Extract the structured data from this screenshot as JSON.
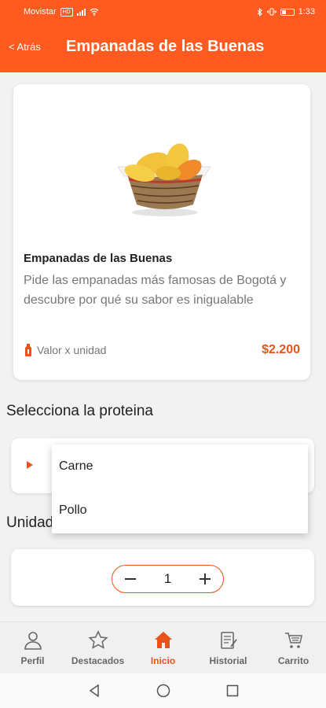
{
  "status_bar": {
    "carrier": "Movistar",
    "network_badge": "HD",
    "time": "1:33"
  },
  "app_bar": {
    "back_label": "< Atrás",
    "title": "Empanadas de las Buenas"
  },
  "product": {
    "name": "Empanadas de las Buenas",
    "description": "Pide las empanadas más famosas de Bogotá y descubre por qué su sabor es inigualable",
    "unit_label": "Valor x unidad",
    "price": "$2.200",
    "image_icon": "empanada-basket-image"
  },
  "protein_section": {
    "title": "Selecciona la proteina",
    "options": [
      "Carne",
      "Pollo"
    ]
  },
  "units_section": {
    "title": "Unidades",
    "quantity": "1"
  },
  "tabs": [
    {
      "label": "Perfil",
      "icon": "user-icon"
    },
    {
      "label": "Destacados",
      "icon": "star-icon"
    },
    {
      "label": "Inicio",
      "icon": "home-icon",
      "active": true
    },
    {
      "label": "Historial",
      "icon": "history-icon"
    },
    {
      "label": "Carrito",
      "icon": "cart-icon"
    }
  ],
  "colors": {
    "primary": "#ff5a1f",
    "accent": "#e8531a",
    "background": "#f2f2f2"
  }
}
